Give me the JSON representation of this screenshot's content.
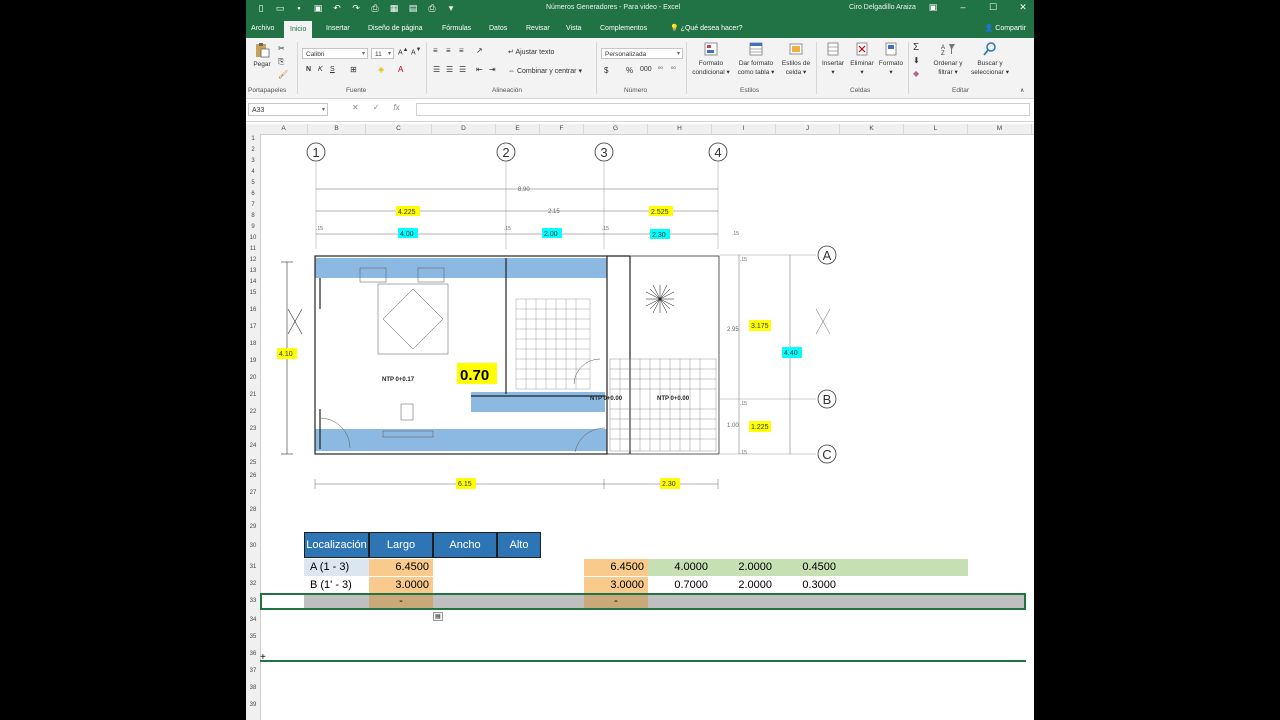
{
  "window": {
    "title": "Números Generadores - Para video - Excel",
    "user": "Ciro Delgadillo Araiza",
    "share_label": "Compartir"
  },
  "tabs": [
    "Archivo",
    "Inicio",
    "Insertar",
    "Diseño de página",
    "Fórmulas",
    "Datos",
    "Revisar",
    "Vista",
    "Complementos",
    "¿Qué desea hacer?"
  ],
  "ribbon": {
    "paste_label": "Pegar",
    "font_name": "Calibri",
    "font_size": "11",
    "wrap_text": "Ajustar texto",
    "merge_center": "Combinar y centrar",
    "number_format": "Personalizada",
    "cond_format_1": "Formato",
    "cond_format_2": "condicional",
    "format_table_1": "Dar formato",
    "format_table_2": "como tabla",
    "cell_styles_1": "Estilos de",
    "cell_styles_2": "celda",
    "insert": "Insertar",
    "delete": "Eliminar",
    "format": "Formato",
    "sort_1": "Ordenar y",
    "sort_2": "filtrar",
    "find_1": "Buscar y",
    "find_2": "seleccionar",
    "groups": {
      "clipboard": "Portapapeles",
      "font": "Fuente",
      "alignment": "Alineación",
      "number": "Número",
      "styles": "Estilos",
      "cells": "Celdas",
      "editing": "Editar"
    }
  },
  "formula_bar": {
    "name_box": "A33",
    "fx": "fx",
    "formula": ""
  },
  "columns": [
    "A",
    "B",
    "C",
    "D",
    "E",
    "F",
    "G",
    "H",
    "I",
    "J",
    "K",
    "L",
    "M"
  ],
  "rows": [
    "1",
    "2",
    "3",
    "4",
    "5",
    "6",
    "7",
    "8",
    "9",
    "10",
    "11",
    "12",
    "13",
    "14",
    "15",
    "16",
    "17",
    "18",
    "19",
    "20",
    "21",
    "22",
    "23",
    "24",
    "25",
    "26",
    "27",
    "28",
    "29",
    "30",
    "31",
    "32",
    "33",
    "34",
    "35",
    "36",
    "37",
    "38",
    "39"
  ],
  "plan": {
    "axis_labels": [
      "1",
      "2",
      "3",
      "4"
    ],
    "row_axis_labels": [
      "A",
      "B",
      "C"
    ],
    "dims_top": {
      "total": "8.90",
      "d1": "4.225",
      "d2": "2.15",
      "d3": "2.525",
      "d4": "4.00",
      "d5": "2.00",
      "d6": "2.30",
      "s1": ".15",
      "s2": ".15",
      "s3": ".15",
      "s4": ".15"
    },
    "dims_bottom": {
      "d1": "6.15",
      "d2": "2.30"
    },
    "dims_left": {
      "d1": "4.10"
    },
    "dims_right": {
      "d1": "3.175",
      "d2": "4.40",
      "d3": "1.225",
      "d4": "2.95",
      "d5": "1.00",
      "s1": ".15",
      "s2": ".15",
      "s3": ".15"
    },
    "callout": "0.70",
    "ntp1": "NTP 0+0.17",
    "ntp2": "NTP 0+0.00"
  },
  "table": {
    "headers": [
      "Localización",
      "Largo",
      "Ancho",
      "Alto"
    ],
    "rows": [
      {
        "loc": "A (1 - 3)",
        "largo": "6.4500",
        "g": "6.4500",
        "h": "4.0000",
        "i": "2.0000",
        "j": "0.4500"
      },
      {
        "loc": "B (1' - 3)",
        "largo": "3.0000",
        "g": "3.0000",
        "h": "0.7000",
        "i": "2.0000",
        "j": "0.3000"
      },
      {
        "loc": "",
        "largo": "-",
        "g": "-",
        "h": "",
        "i": "",
        "j": ""
      }
    ]
  },
  "colors": {
    "excel_green": "#217346",
    "header_blue": "#2e75b6",
    "light_blue_cell": "#dce6f1",
    "orange_cell": "#f8cb8d",
    "green_cell": "#c6e0b4",
    "gray_cell": "#bfbfbf",
    "yellow_dim": "#ffff00",
    "cyan_dim": "#00ffff"
  }
}
